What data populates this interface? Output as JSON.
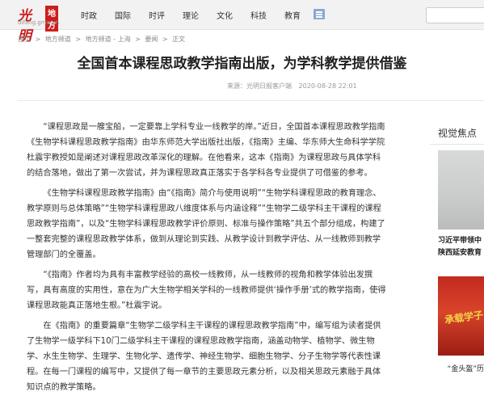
{
  "header": {
    "logo_text": "光明",
    "logo_box": "地方",
    "logo_domain": "difang.gmw.cn",
    "nav": [
      "时政",
      "国际",
      "时评",
      "理论",
      "文化",
      "科技",
      "教育"
    ]
  },
  "breadcrumb": [
    "首页",
    ">",
    "地方频道",
    ">",
    "地方频道 - 上海",
    ">",
    "要闻",
    ">",
    "正文"
  ],
  "article": {
    "title": "全国首本课程思政教学指南出版，为学科教学提供借鉴",
    "source": "来源：光明日报客户端",
    "date": "2020-08-28 22:01",
    "paragraphs": [
      "“课程思政是一艘宝船，一定要靠上学科专业一线教学的岸。”近日，全国首本课程思政教学指南《生物学科课程思政教学指南》由华东师范大学出版社出版，《指南》主编、华东师大生命科学学院杜震宇教授如是阐述对课程思政改革深化的理解。在他看来，这本《指南》为课程思政与具体学科的结合落地，做出了第一次尝试，并为课程思政真正落实于各学科各专业提供了可借鉴的参考。",
      "《生物学科课程思政教学指南》由“《指南》简介与使用说明”“生物学科课程思政的教育理念、教学原则与总体策略”“生物学科课程思政八维度体系与内涵诠释”“生物学二级学科主干课程的课程思政教学指南”，以及“生物学科课程思政教学评价原则、标准与操作策略”共五个部分组成，构建了一整套完整的课程思政教学体系，做到从理论到实践、从教学设计到教学评估、从一线教师到教学管理部门的全覆盖。",
      "“《指南》作者均为具有丰富教学经验的高校一线教师，从一线教师的视角和教学体验出发撰写，具有高度的实用性，意在为广大生物学相关学科的一线教师提供‘操作手册’式的教学指南，使得课程思政能真正落地生根。”杜震宇说。",
      "在《指南》的重要篇章“生物学二级学科主干课程的课程思政教学指南”中，编写组为读者提供了生物学一级学科下10门二级学科主干课程的课程思政教学指南，涵盖动物学、植物学、微生物学、水生生物学、生理学、生物化学、遗传学、神经生物学、细胞生物学、分子生物学等代表性课程。在每一门课程的编写中，又提供了每一章节的主要思政元素分析，以及相关思政元素融于具体知识点的教学策略。"
    ]
  },
  "sidebar": {
    "title": "视觉焦点",
    "items": [
      {
        "caption": "习近平带领中",
        "caption2": "陕西延安教育"
      },
      {
        "image_text": "承载学子",
        "caption": "“金头盔”历"
      }
    ]
  }
}
